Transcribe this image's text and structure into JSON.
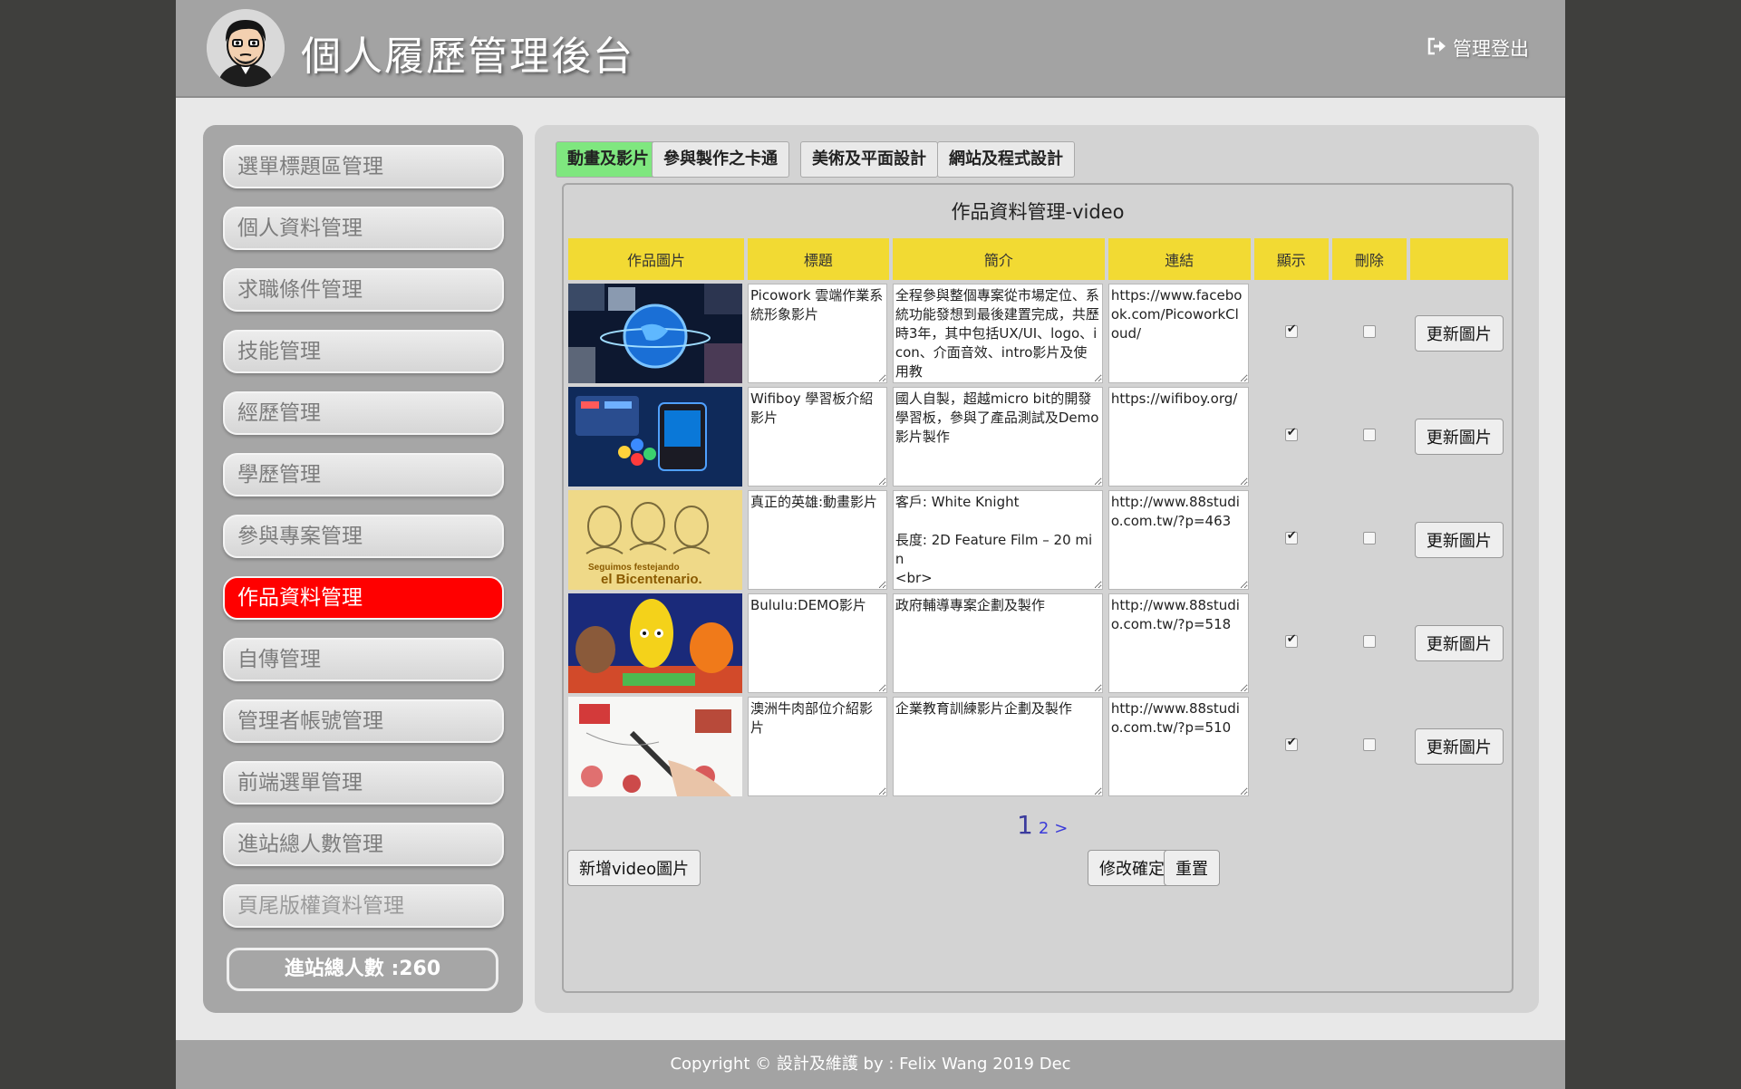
{
  "header": {
    "title": "個人履歷管理後台",
    "logout_label": "管理登出"
  },
  "sidebar": {
    "items": [
      {
        "label": "選單標題區管理"
      },
      {
        "label": "個人資料管理"
      },
      {
        "label": "求職條件管理"
      },
      {
        "label": "技能管理"
      },
      {
        "label": "經歷管理"
      },
      {
        "label": "學歷管理"
      },
      {
        "label": "參與專案管理"
      },
      {
        "label": "作品資料管理"
      },
      {
        "label": "自傳管理"
      },
      {
        "label": "管理者帳號管理"
      },
      {
        "label": "前端選單管理"
      },
      {
        "label": "進站總人數管理"
      },
      {
        "label": "頁尾版權資料管理"
      }
    ],
    "active_index": 7,
    "visitors_label": "進站總人數 :260"
  },
  "tabs": [
    {
      "label": "動畫及影片"
    },
    {
      "label": "參與製作之卡通"
    },
    {
      "label": "美術及平面設計"
    },
    {
      "label": "網站及程式設計"
    }
  ],
  "content": {
    "title": "作品資料管理-video",
    "columns": [
      "作品圖片",
      "標題",
      "簡介",
      "連結",
      "顯示",
      "刪除",
      ""
    ],
    "rows": [
      {
        "title": "Picowork 雲端作業系統形象影片",
        "intro": "全程參與整個專案從市場定位、系統功能發想到最後建置完成，共歷時3年，其中包括UX/UI、logo、icon、介面音效、intro影片及使用教",
        "link": "https://www.facebook.com/PicoworkCloud/",
        "show": true,
        "delete": false,
        "update_label": "更新圖片"
      },
      {
        "title": "Wifiboy 學習板介紹影片",
        "intro": "國人自製，超越micro bit的開發學習板，參與了產品測試及Demo影片製作",
        "link": "https://wifiboy.org/",
        "show": true,
        "delete": false,
        "update_label": "更新圖片"
      },
      {
        "title": "真正的英雄:動畫影片",
        "intro_lines": [
          "客戶: White Knight",
          "",
          "長度: 2D Feature Film – 20 min",
          "<br>"
        ],
        "link": "http://www.88studio.com.tw/?p=463",
        "show": true,
        "delete": false,
        "update_label": "更新圖片"
      },
      {
        "title": "Bululu:DEMO影片",
        "intro": "政府輔導專案企劃及製作",
        "link": "http://www.88studio.com.tw/?p=518",
        "show": true,
        "delete": false,
        "update_label": "更新圖片"
      },
      {
        "title": "澳洲牛肉部位介紹影片",
        "intro": "企業教育訓練影片企劃及製作",
        "link": "http://www.88studio.com.tw/?p=510",
        "show": true,
        "delete": false,
        "update_label": "更新圖片"
      }
    ],
    "thumb3_caption_1": "Seguimos festejando",
    "thumb3_caption_2": "el Bicentenario.",
    "pager": {
      "current": "1",
      "next": "2",
      "arrow": ">"
    },
    "add_button": "新增video圖片",
    "confirm_button": "修改確定",
    "reset_button": "重置"
  },
  "footer": {
    "text": "Copyright © 設計及維護 by : Felix Wang 2019 Dec"
  }
}
